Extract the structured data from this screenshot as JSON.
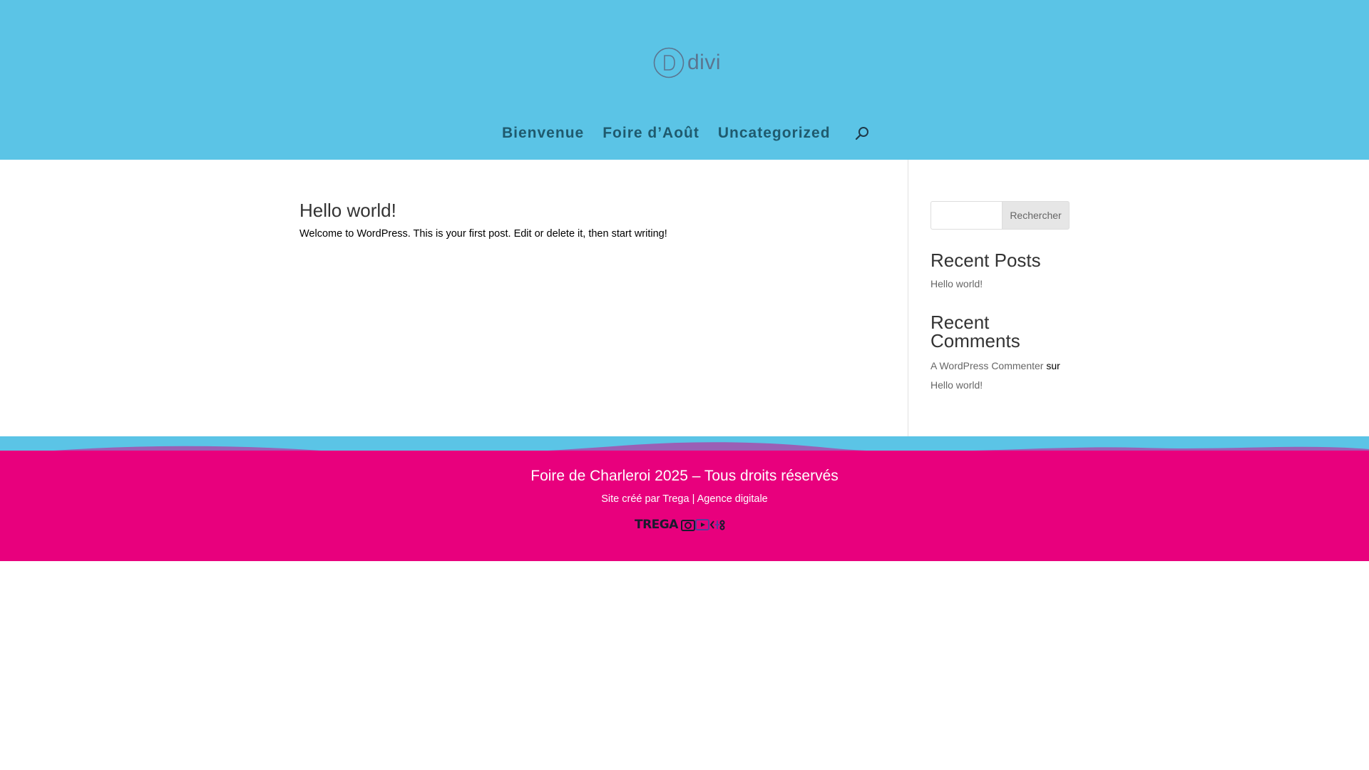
{
  "header": {
    "logo_text": "divi",
    "logo_icon": "divi-d-icon",
    "nav": [
      {
        "label": "Bienvenue"
      },
      {
        "label": "Foire d’Août"
      },
      {
        "label": "Uncategorized"
      }
    ],
    "search_icon": "search-icon"
  },
  "post": {
    "title": "Hello world!",
    "excerpt": "Welcome to WordPress. This is your first post. Edit or delete it, then start writing!"
  },
  "sidebar": {
    "search": {
      "value": "",
      "button_label": "Rechercher"
    },
    "recent_posts": {
      "title": "Recent Posts",
      "items": [
        "Hello world!"
      ]
    },
    "recent_comments": {
      "title": "Recent Comments",
      "author": "A WordPress Commenter",
      "connector": "sur",
      "post": "Hello world!"
    }
  },
  "footer": {
    "title": "Foire de Charleroi 2025 – Tous droits réservés",
    "credit_prefix": "Site créé par ",
    "credit_link": "Trega | Agence digitale",
    "logo_text": "TREGA",
    "logo_icons": [
      "camera-icon",
      "play-icon",
      "code-icon"
    ]
  },
  "colors": {
    "header_bg": "#5bc4e6",
    "nav_text": "#1f5a6e",
    "footer_bg": "#e8007d",
    "footer_wave": "#9b5fb5"
  }
}
